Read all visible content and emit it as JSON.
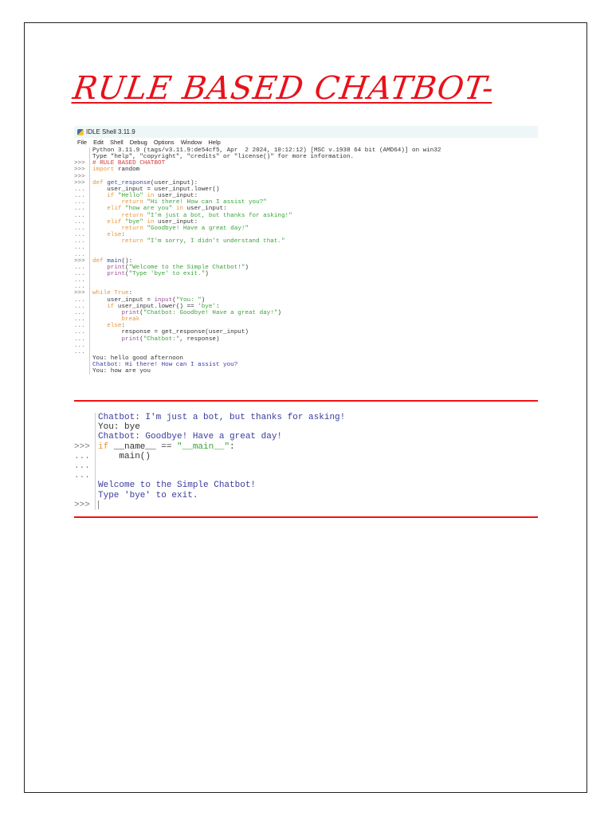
{
  "document": {
    "title": "RULE BASED CHATBOT-"
  },
  "window": {
    "title": "IDLE Shell 3.11.9",
    "menu": [
      "File",
      "Edit",
      "Shell",
      "Debug",
      "Options",
      "Window",
      "Help"
    ]
  },
  "shell1": [
    {
      "p": "",
      "s": [
        [
          "c-n",
          "Python 3.11.9 (tags/v3.11.9:de54cf5, Apr  2 2024, 10:12:12) [MSC v.1938 64 bit (AMD64)] on win32"
        ]
      ]
    },
    {
      "p": "",
      "s": [
        [
          "c-n",
          "Type \"help\", \"copyright\", \"credits\" or \"license()\" for more information."
        ]
      ]
    },
    {
      "p": ">>>",
      "s": [
        [
          "c-cm",
          "# RULE BASED CHATBOT"
        ]
      ]
    },
    {
      "p": ">>>",
      "s": [
        [
          "c-kw",
          "import"
        ],
        [
          "c-n",
          " random"
        ]
      ]
    },
    {
      "p": ">>>",
      "s": []
    },
    {
      "p": ">>>",
      "s": [
        [
          "c-kw",
          "def "
        ],
        [
          "c-def",
          "get_response"
        ],
        [
          "c-n",
          "(user_input):"
        ]
      ]
    },
    {
      "p": "...",
      "s": [
        [
          "c-n",
          "    user_input = user_input.lower()"
        ]
      ]
    },
    {
      "p": "...",
      "s": [
        [
          "c-kw",
          "    if "
        ],
        [
          "c-str",
          "\"Hello\""
        ],
        [
          "c-kw",
          " in"
        ],
        [
          "c-n",
          " user_input:"
        ]
      ]
    },
    {
      "p": "...",
      "s": [
        [
          "c-kw",
          "        return "
        ],
        [
          "c-str",
          "\"Hi there! How can I assist you?\""
        ]
      ]
    },
    {
      "p": "...",
      "s": [
        [
          "c-kw",
          "    elif "
        ],
        [
          "c-str",
          "\"how are you\""
        ],
        [
          "c-kw",
          " in"
        ],
        [
          "c-n",
          " user_input:"
        ]
      ]
    },
    {
      "p": "...",
      "s": [
        [
          "c-kw",
          "        return "
        ],
        [
          "c-str",
          "\"I'm just a bot, but thanks for asking!\""
        ]
      ]
    },
    {
      "p": "...",
      "s": [
        [
          "c-kw",
          "    elif "
        ],
        [
          "c-str",
          "\"bye\""
        ],
        [
          "c-kw",
          " in"
        ],
        [
          "c-n",
          " user_input:"
        ]
      ]
    },
    {
      "p": "...",
      "s": [
        [
          "c-kw",
          "        return "
        ],
        [
          "c-str",
          "\"Goodbye! Have a great day!\""
        ]
      ]
    },
    {
      "p": "...",
      "s": [
        [
          "c-kw",
          "    else"
        ],
        [
          "c-n",
          ":"
        ]
      ]
    },
    {
      "p": "...",
      "s": [
        [
          "c-kw",
          "        return "
        ],
        [
          "c-str",
          "\"I'm sorry, I didn't understand that.\""
        ]
      ]
    },
    {
      "p": "...",
      "s": []
    },
    {
      "p": "...",
      "s": []
    },
    {
      "p": ">>>",
      "s": [
        [
          "c-kw",
          "def "
        ],
        [
          "c-def",
          "main"
        ],
        [
          "c-n",
          "():"
        ]
      ]
    },
    {
      "p": "...",
      "s": [
        [
          "c-bi",
          "    print"
        ],
        [
          "c-n",
          "("
        ],
        [
          "c-str",
          "\"Welcome to the Simple Chatbot!\""
        ],
        [
          "c-n",
          ")"
        ]
      ]
    },
    {
      "p": "...",
      "s": [
        [
          "c-bi",
          "    print"
        ],
        [
          "c-n",
          "("
        ],
        [
          "c-str",
          "\"Type 'bye' to exit.\""
        ],
        [
          "c-n",
          ")"
        ]
      ]
    },
    {
      "p": "...",
      "s": []
    },
    {
      "p": "...",
      "s": []
    },
    {
      "p": ">>>",
      "s": [
        [
          "c-kw",
          "while True"
        ],
        [
          "c-n",
          ":"
        ]
      ]
    },
    {
      "p": "...",
      "s": [
        [
          "c-n",
          "    user_input = "
        ],
        [
          "c-bi",
          "input"
        ],
        [
          "c-n",
          "("
        ],
        [
          "c-str",
          "\"You: \""
        ],
        [
          "c-n",
          ")"
        ]
      ]
    },
    {
      "p": "...",
      "s": [
        [
          "c-kw",
          "    if"
        ],
        [
          "c-n",
          " user_input.lower() == "
        ],
        [
          "c-str",
          "'bye'"
        ],
        [
          "c-n",
          ":"
        ]
      ]
    },
    {
      "p": "...",
      "s": [
        [
          "c-bi",
          "        print"
        ],
        [
          "c-n",
          "("
        ],
        [
          "c-str",
          "\"Chatbot: Goodbye! Have a great day!\""
        ],
        [
          "c-n",
          ")"
        ]
      ]
    },
    {
      "p": "...",
      "s": [
        [
          "c-kw",
          "        break"
        ]
      ]
    },
    {
      "p": "...",
      "s": [
        [
          "c-kw",
          "    else"
        ],
        [
          "c-n",
          ":"
        ]
      ]
    },
    {
      "p": "...",
      "s": [
        [
          "c-n",
          "        response = get_response(user_input)"
        ]
      ]
    },
    {
      "p": "...",
      "s": [
        [
          "c-bi",
          "        print"
        ],
        [
          "c-n",
          "("
        ],
        [
          "c-str",
          "\"Chatbot:\""
        ],
        [
          "c-n",
          ", response)"
        ]
      ]
    },
    {
      "p": "...",
      "s": []
    },
    {
      "p": "...",
      "s": []
    },
    {
      "p": "",
      "s": [
        [
          "c-in",
          "You: hello good afternoon"
        ]
      ]
    },
    {
      "p": "",
      "s": [
        [
          "c-out",
          "Chatbot: Hi there! How can I assist you?"
        ]
      ]
    },
    {
      "p": "",
      "s": [
        [
          "c-in",
          "You: how are you"
        ]
      ]
    }
  ],
  "shell2": [
    {
      "p": "",
      "s": [
        [
          "c-out",
          "Chatbot: I'm just a bot, but thanks for asking!"
        ]
      ]
    },
    {
      "p": "",
      "s": [
        [
          "c-in",
          "You: bye"
        ]
      ]
    },
    {
      "p": "",
      "s": [
        [
          "c-out",
          "Chatbot: Goodbye! Have a great day!"
        ]
      ]
    },
    {
      "p": ">>>",
      "s": [
        [
          "c-kw",
          "if"
        ],
        [
          "c-n",
          " __name__ == "
        ],
        [
          "c-str",
          "\"__main__\""
        ],
        [
          "c-n",
          ":"
        ]
      ]
    },
    {
      "p": "...",
      "s": [
        [
          "c-n",
          "    main()"
        ]
      ]
    },
    {
      "p": "...",
      "s": []
    },
    {
      "p": "...",
      "s": []
    },
    {
      "p": "",
      "s": [
        [
          "c-out",
          "Welcome to the Simple Chatbot!"
        ]
      ]
    },
    {
      "p": "",
      "s": [
        [
          "c-out",
          "Type 'bye' to exit."
        ]
      ]
    },
    {
      "p": ">>>",
      "s": [],
      "caret": true
    }
  ]
}
